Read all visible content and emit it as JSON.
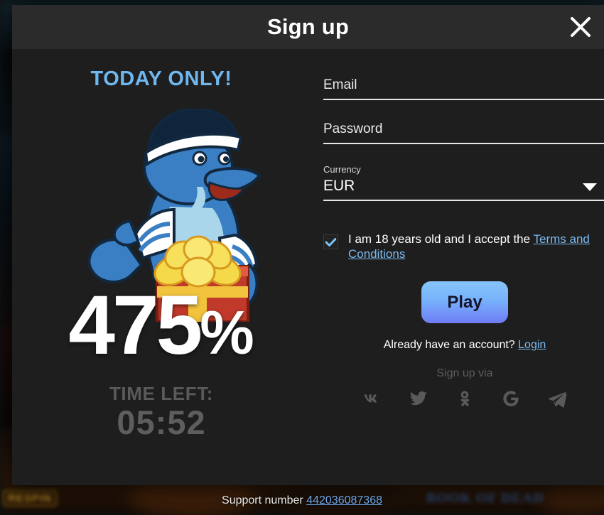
{
  "background": {
    "tiles": [
      {
        "label": "RESPIN"
      },
      {
        "label": "BOOK OF DEAD"
      }
    ]
  },
  "modal": {
    "header": {
      "title": "Sign up",
      "close_icon": "close-icon"
    },
    "promo": {
      "headline": "TODAY ONLY!",
      "mascot_name": "dolphin-sailor-mascot",
      "percent_value": "475",
      "percent_sign": "%",
      "timer_label": "TIME LEFT:",
      "timer_value": "05:52"
    },
    "form": {
      "email": {
        "placeholder": "Email",
        "value": ""
      },
      "password": {
        "placeholder": "Password",
        "value": ""
      },
      "currency": {
        "label": "Currency",
        "selected": "EUR",
        "caret_icon": "chevron-down-icon"
      },
      "terms": {
        "checked": true,
        "text_before": "I am 18 years old and I accept the ",
        "link_text": "Terms and Conditions"
      },
      "play_label": "Play",
      "login_prompt": "Already have an account? ",
      "login_link": "Login",
      "social_label": "Sign up via",
      "social_icons": [
        {
          "name": "vk-icon"
        },
        {
          "name": "twitter-icon"
        },
        {
          "name": "odnoklassniki-icon"
        },
        {
          "name": "google-icon"
        },
        {
          "name": "telegram-icon"
        }
      ]
    }
  },
  "support": {
    "text": "Support number ",
    "number": "442036087368"
  },
  "colors": {
    "modal_bg": "#1e1e1e",
    "header_bg": "#2b2b2b",
    "accent_blue": "#6fb7ef",
    "link_blue": "#7cb9ee",
    "play_gradient_top": "#86c5fb",
    "play_gradient_bottom": "#6f7cf5",
    "timer_grey": "#5a5a5a"
  }
}
